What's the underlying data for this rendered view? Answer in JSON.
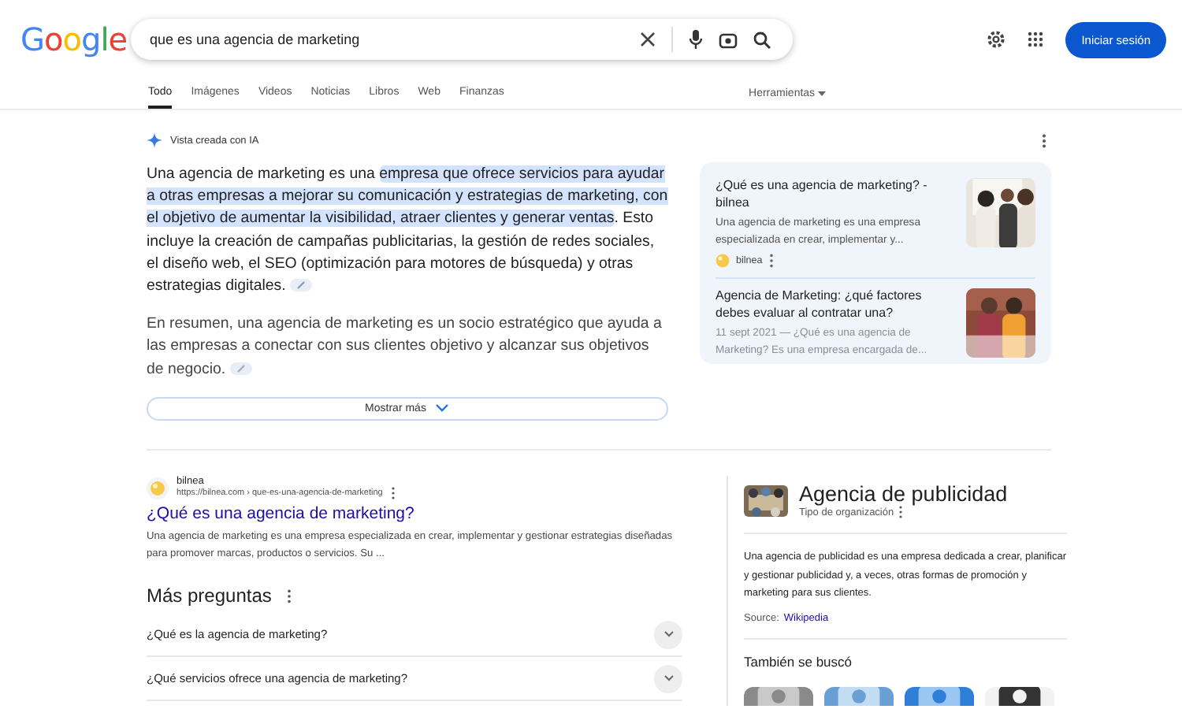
{
  "logo": "Google",
  "search": {
    "value": "que es una agencia de marketing"
  },
  "header": {
    "sign_in": "Iniciar sesión"
  },
  "tabs": [
    {
      "label": "Todo",
      "selected": true
    },
    {
      "label": "Imágenes",
      "selected": false
    },
    {
      "label": "Videos",
      "selected": false
    },
    {
      "label": "Noticias",
      "selected": false
    },
    {
      "label": "Libros",
      "selected": false
    },
    {
      "label": "Web",
      "selected": false
    },
    {
      "label": "Finanzas",
      "selected": false
    }
  ],
  "tools": "Herramientas",
  "ai_overview": {
    "label": "Vista creada con IA",
    "paragraph_1": {
      "before": "Una agencia de marketing es una ",
      "highlight": "empresa que ofrece servicios para ayudar a otras empresas a mejorar su comunicación y estrategias de marketing, con el objetivo de aumentar la visibilidad, atraer clientes y generar ventas",
      "after": ". Esto incluye la creación de campañas publicitarias, la gestión de redes sociales, el diseño web, el SEO (optimización para motores de búsqueda) y otras estrategias digitales."
    },
    "paragraph_2": "En resumen, una agencia de marketing es un socio estratégico que ayuda a las empresas a conectar con sus clientes objetivo y alcanzar sus objetivos de negocio.",
    "show_more": "Mostrar más",
    "sources": [
      {
        "title": "¿Qué es una agencia de marketing? - bilnea",
        "snippet": "Una agencia de marketing es una empresa especializada en crear, implementar y...",
        "site": "bilnea"
      },
      {
        "title": "Agencia de Marketing: ¿qué factores debes evaluar al contratar una?",
        "snippet": "11 sept 2021 — ¿Qué es una agencia de Marketing? Es una empresa encargada de..."
      }
    ]
  },
  "result": {
    "site": "bilnea",
    "url": "https://bilnea.com › que-es-una-agencia-de-marketing",
    "title": "¿Qué es una agencia de marketing?",
    "snippet": "Una agencia de marketing es una empresa especializada en crear, implementar y gestionar estrategias diseñadas para promover marcas, productos o servicios. Su ..."
  },
  "more_questions": {
    "title": "Más preguntas",
    "items": [
      {
        "text": "¿Qué es la agencia de marketing?",
        "expanded": false
      },
      {
        "text": "¿Qué servicios ofrece una agencia de marketing?",
        "expanded": false
      }
    ]
  },
  "knowledge_panel": {
    "title": "Agencia de publicidad",
    "subtitle": "Tipo de organización",
    "description": "Una agencia de publicidad es una empresa dedicada a crear, planificar y gestionar publicidad y, a veces, otras formas de promoción y marketing para sus clientes.",
    "source_label": "Source:",
    "source_link": "Wikipedia",
    "also_searched": "También se buscó"
  }
}
